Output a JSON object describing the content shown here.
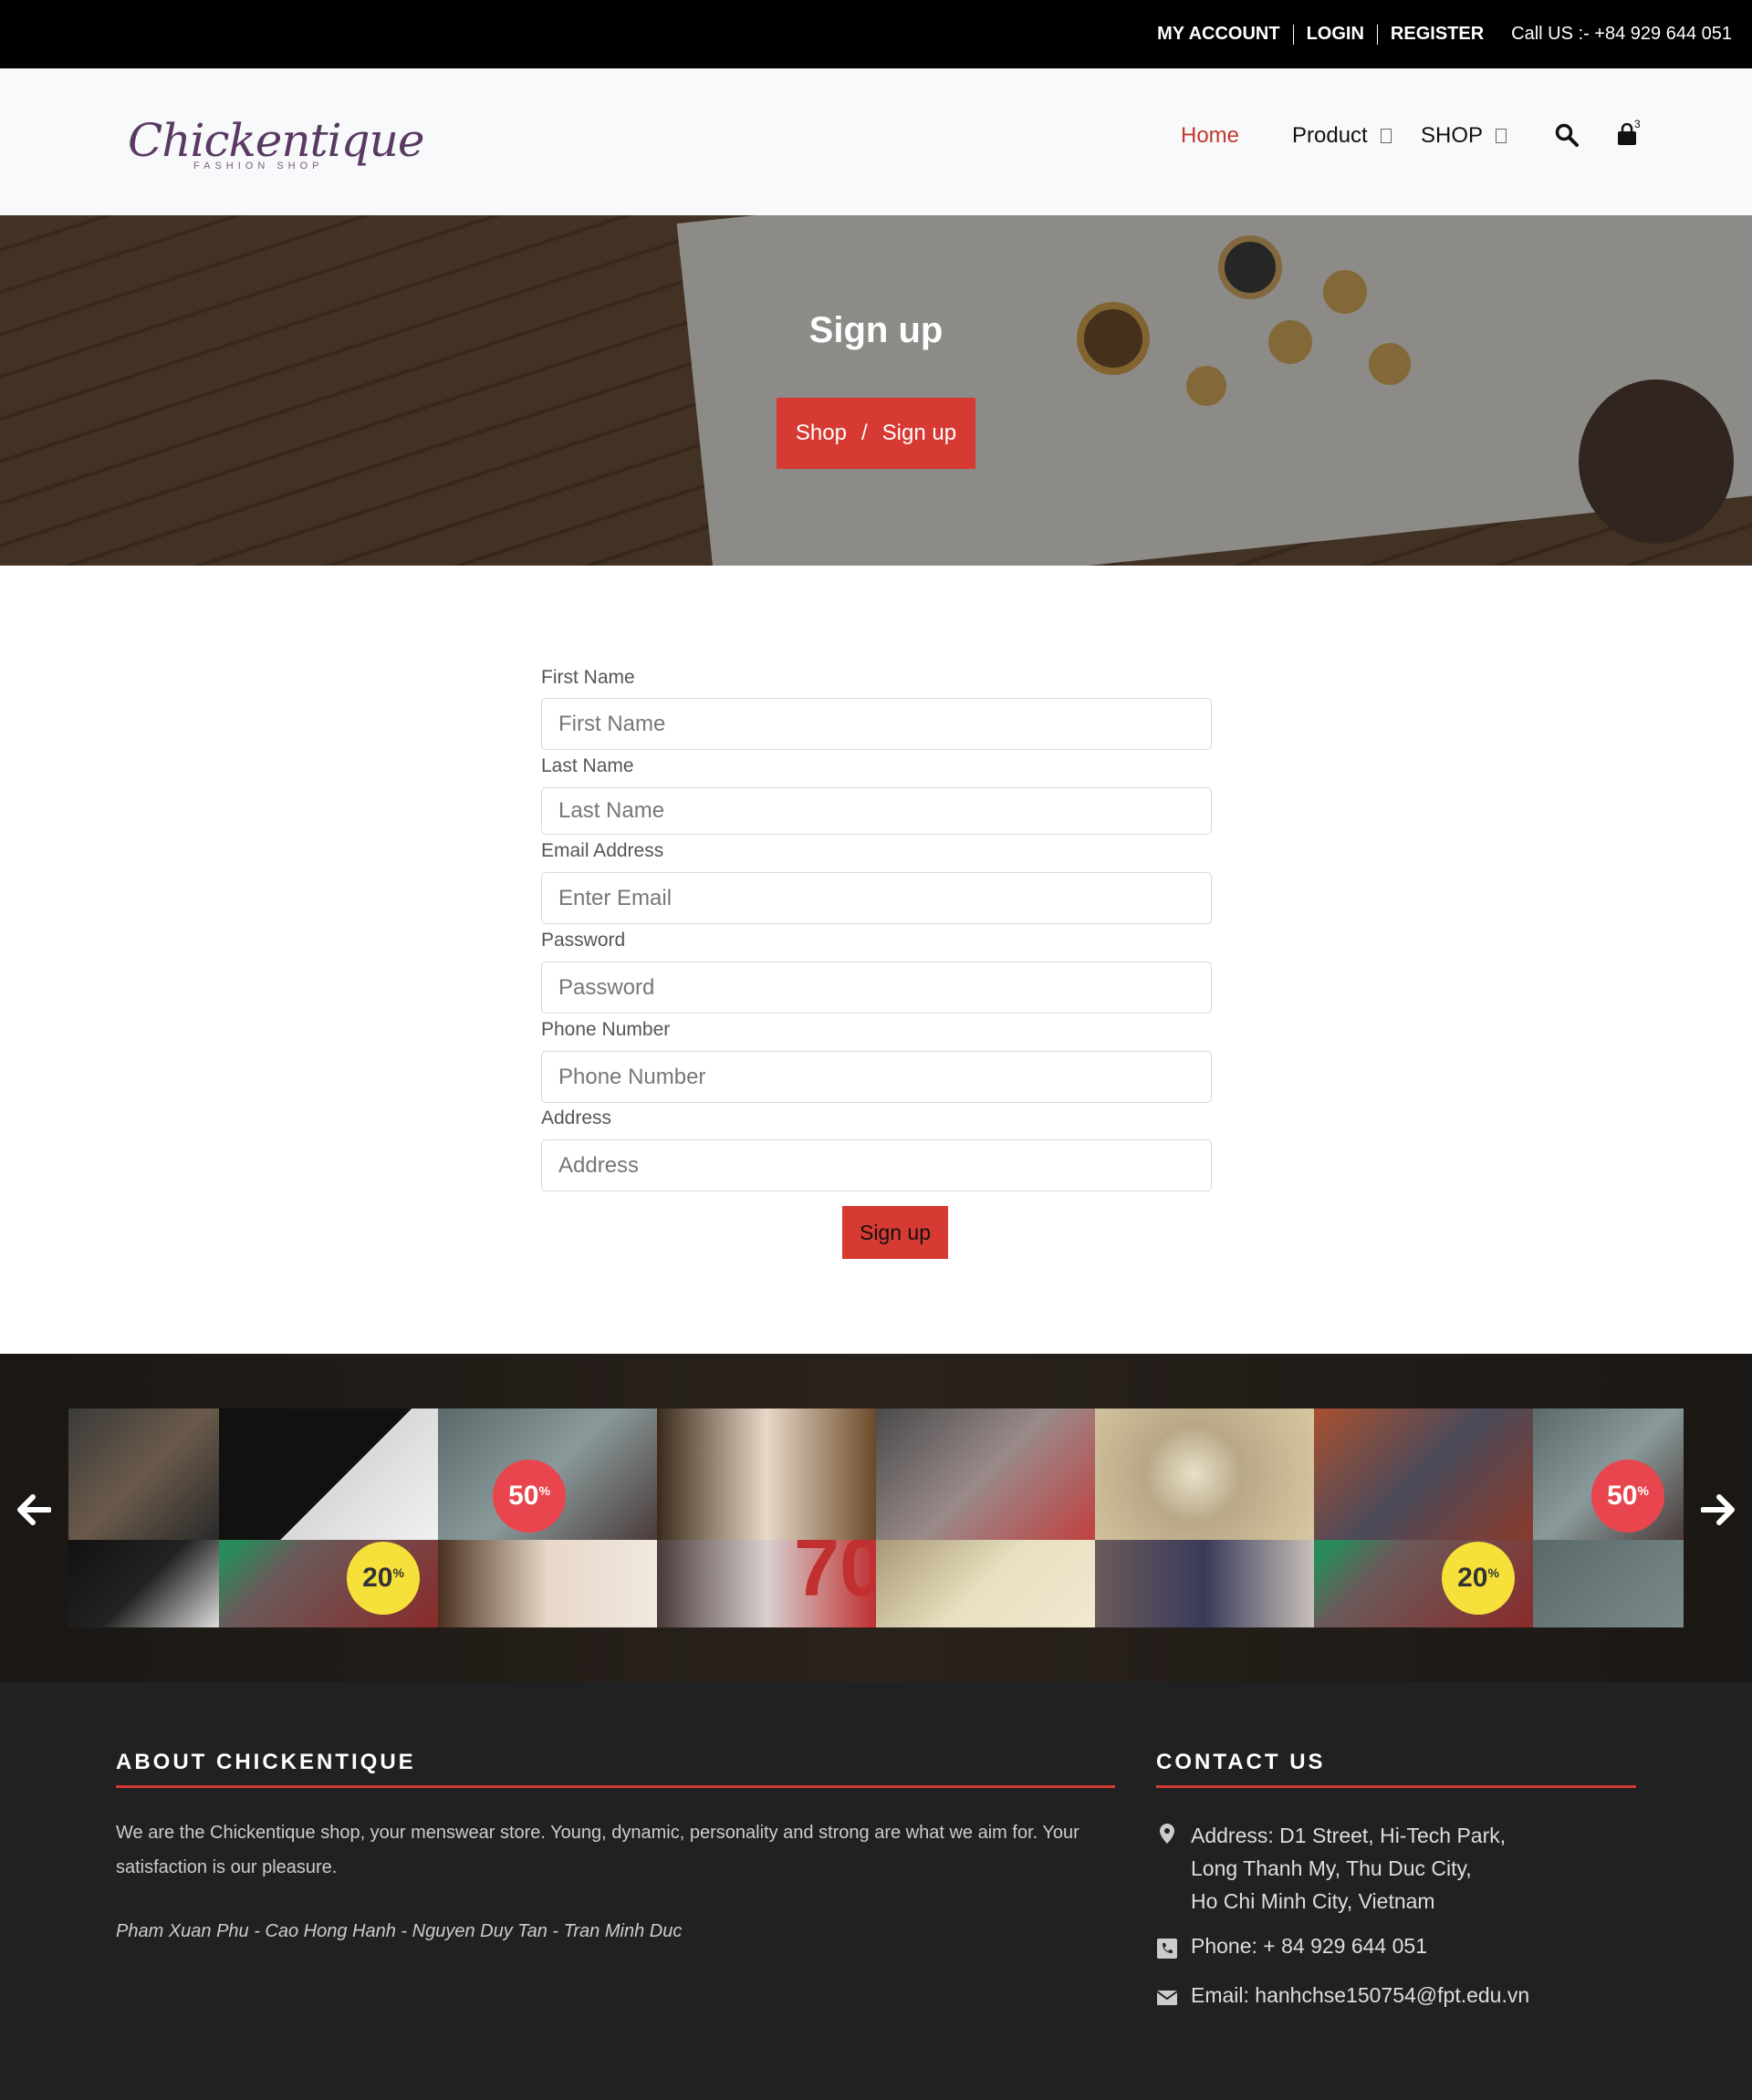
{
  "topbar": {
    "my_account": "MY ACCOUNT",
    "login": "LOGIN",
    "register": "REGISTER",
    "call": "Call US :- +84 929 644 051"
  },
  "logo": {
    "brand": "Chickentique",
    "tagline": "FASHION SHOP"
  },
  "nav": {
    "home": "Home",
    "product": "Product",
    "shop": "SHOP",
    "cart_count": "3"
  },
  "hero": {
    "title": "Sign up",
    "breadcrumb_parent": "Shop",
    "breadcrumb_separator": "/",
    "breadcrumb_current": "Sign up"
  },
  "form": {
    "fields": [
      {
        "label": "First Name",
        "placeholder": "First Name"
      },
      {
        "label": "Last Name",
        "placeholder": "Last Name"
      },
      {
        "label": "Email Address",
        "placeholder": "Enter Email"
      },
      {
        "label": "Password",
        "placeholder": "Password"
      },
      {
        "label": "Phone Number",
        "placeholder": "Phone Number"
      },
      {
        "label": "Address",
        "placeholder": "Address"
      }
    ],
    "submit": "Sign up"
  },
  "carousel": {
    "prev_icon": "arrow-left-icon",
    "next_icon": "arrow-right-icon",
    "badges": [
      {
        "value": "50",
        "unit": "%",
        "color": "#e8454e"
      },
      {
        "value": "20",
        "unit": "%",
        "color": "#f5e13a"
      },
      {
        "value": "50",
        "unit": "%",
        "color": "#e8454e"
      },
      {
        "value": "20",
        "unit": "%",
        "color": "#f5e13a"
      }
    ],
    "poster_text": "70"
  },
  "footer": {
    "about_heading": "ABOUT CHICKENTIQUE",
    "about_text": "We are the Chickentique shop, your menswear store. Young, dynamic, personality and strong are what we aim for. Your satisfaction is our pleasure.",
    "authors": "Pham Xuan Phu - Cao Hong Hanh - Nguyen Duy Tan - Tran Minh Duc",
    "contact_heading": "CONTACT US",
    "address_1": "Address: D1 Street, Hi-Tech Park,",
    "address_2": "Long Thanh My, Thu Duc City,",
    "address_3": "Ho Chi Minh City, Vietnam",
    "phone": "Phone: + 84 929 644 051",
    "email": "Email: hanhchse150754@fpt.edu.vn"
  },
  "colors": {
    "accent": "#d63a32",
    "nav_active": "#c0392b",
    "footer_bg": "#212121",
    "topbar_bg": "#000000"
  }
}
